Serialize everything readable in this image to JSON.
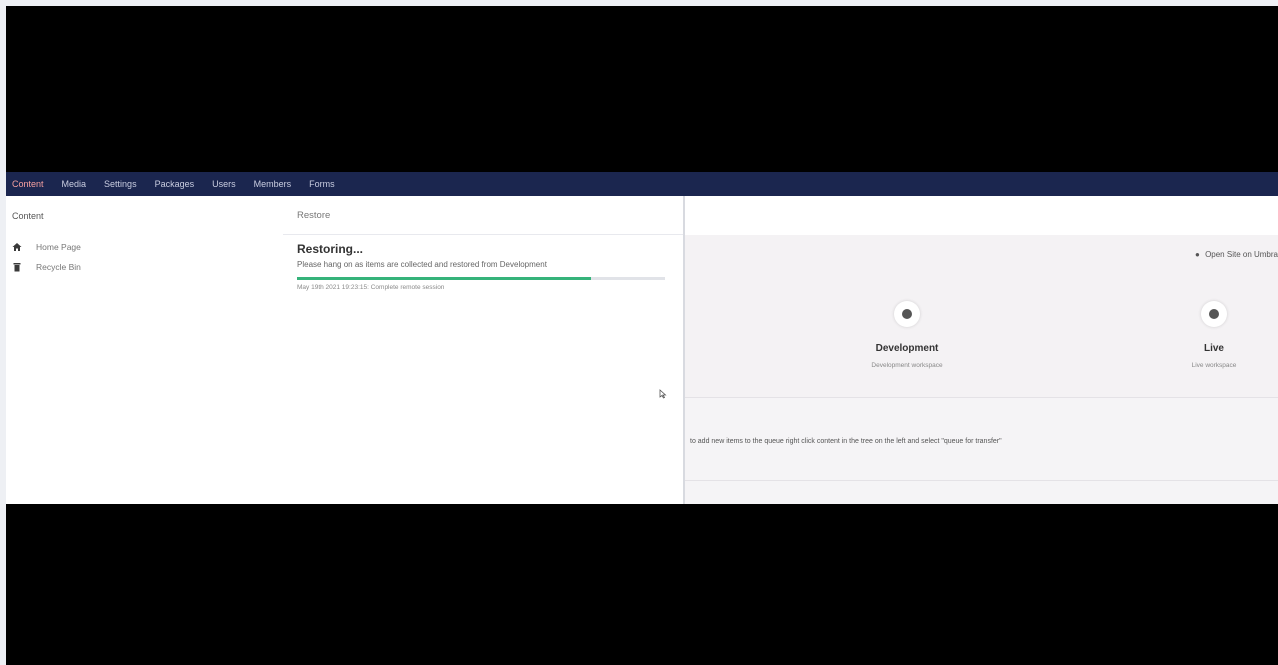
{
  "nav": {
    "items": [
      "Content",
      "Media",
      "Settings",
      "Packages",
      "Users",
      "Members",
      "Forms"
    ],
    "active_color": "#f5a0a0",
    "bar_color": "#1b264f"
  },
  "tree": {
    "title": "Content",
    "items": [
      {
        "label": "Home Page",
        "icon": "home-icon"
      },
      {
        "label": "Recycle Bin",
        "icon": "trash-icon"
      }
    ]
  },
  "dialog": {
    "title": "Restore",
    "heading": "Restoring...",
    "message": "Please hang on as items are collected and restored from Development",
    "progress": 0.8,
    "progress_color": "#35b37a",
    "log": "May 19th 2021 19:23:15: Complete remote session"
  },
  "workspace": {
    "open_site": "Open Site on Umbra",
    "environments": [
      {
        "name": "Development",
        "sub": "Development workspace"
      },
      {
        "name": "Live",
        "sub": "Live workspace"
      }
    ],
    "queue_hint": "to add new items to the queue right click content in the tree on the left and select \"queue for transfer\""
  }
}
